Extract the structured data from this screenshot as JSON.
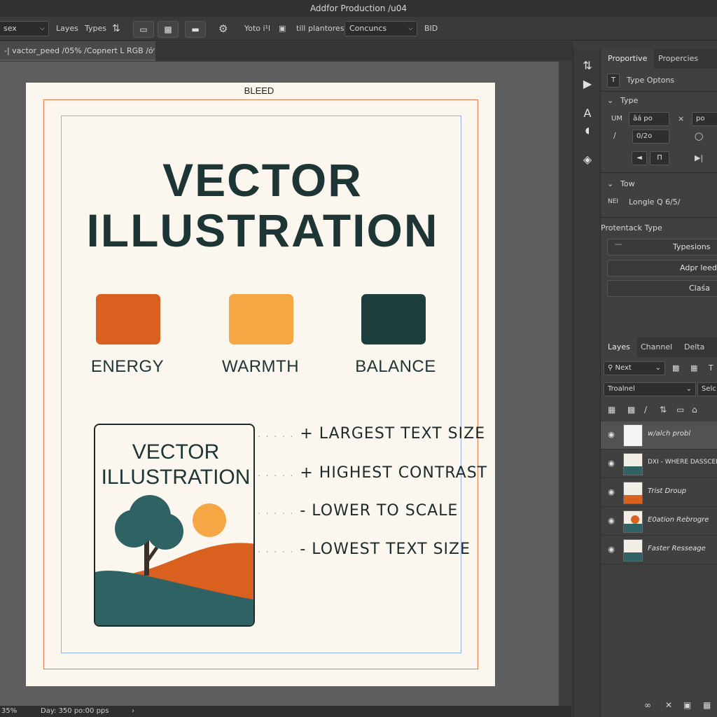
{
  "app": {
    "title": "Addfor Production /u04"
  },
  "options_bar": {
    "preset": "sex",
    "layes": "Layes",
    "types": "Types",
    "yoto": "Yoto i¹l",
    "till": "till plantores",
    "font": "Concuncs",
    "bid": "BID"
  },
  "document": {
    "tab": "-| vactor_peed /05% /Copnert L RGB /óʳ"
  },
  "artboard": {
    "bleed_label": "BLEED",
    "title_line1": "VECTOR",
    "title_line2": "ILLUSTRATION",
    "swatches": [
      {
        "label": "ENERGY",
        "color": "#d9601f"
      },
      {
        "label": "WARMTH",
        "color": "#f4a743"
      },
      {
        "label": "BALANCE",
        "color": "#1d3e3c"
      }
    ],
    "card": {
      "title_line1": "VECTOR",
      "title_line2": "ILLUSTRATION"
    },
    "hierarchy": [
      {
        "dots": ". . . . .",
        "text": "+ LARGEST TEXT SIZE"
      },
      {
        "dots": ". . . . .",
        "text": "+ HIGHEST CONTRAST"
      },
      {
        "dots": ". . . . .",
        "text": "- LOWER TO SCALE"
      },
      {
        "dots": ". . . . .",
        "text": "- LOWEST TEXT SIZE"
      }
    ]
  },
  "status_bar": {
    "left": "35%",
    "info": "Day: 350 po:00 pps"
  },
  "panel": {
    "tabs": [
      "Proportive",
      "Propercies"
    ],
    "type_options": "Type Optons",
    "type_section": "Type",
    "um_label": "UM",
    "field1": "āá po",
    "field2": "po",
    "field3": "0/2o",
    "tow_section": "Tow",
    "nei_label": "NEI",
    "longle_value": "Longle Q 6/5/",
    "protentack_title": "Protentack Type",
    "btn_typesions": "Typesions",
    "btn_scribble": "′′′′′",
    "btn_adpr": "Adpr leed",
    "btn_clasa": "Claśa"
  },
  "layers_panel": {
    "tabs": [
      "Layes",
      "Channel",
      "Delta"
    ],
    "filter": "Next",
    "blend": "Troalnel",
    "opacity": "Selc",
    "layers": [
      {
        "name": "w/alch probl"
      },
      {
        "name": "DXI - WHERE DASSCER"
      },
      {
        "name": "Trist Droup"
      },
      {
        "name": "E0ation Rebrogre"
      },
      {
        "name": "Faster Resseage"
      }
    ]
  },
  "colors": {
    "accent_orange": "#d9601f",
    "accent_yellow": "#f4a743",
    "accent_teal": "#1d3e3c",
    "bleed": "#e07a4f",
    "margin": "#8fb3e8"
  }
}
